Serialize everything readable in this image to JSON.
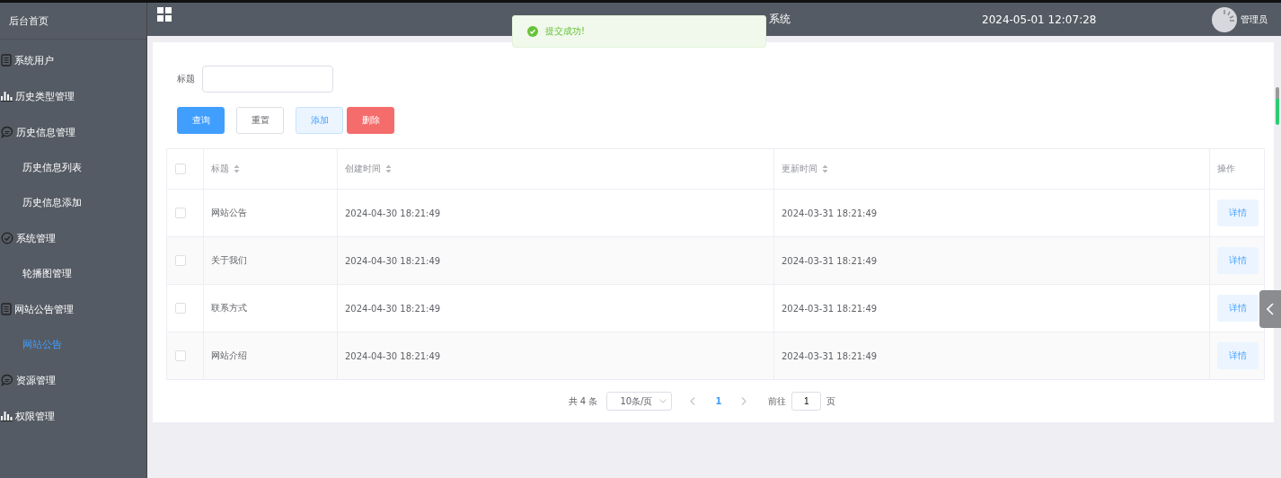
{
  "sidebar": {
    "items": [
      {
        "label": "后台首页",
        "kind": "plain",
        "selected": false
      },
      {
        "label": "系统用户",
        "kind": "doc",
        "selected": false
      },
      {
        "label": "历史类型管理",
        "kind": "bars",
        "selected": false
      },
      {
        "label": "历史信息管理",
        "kind": "chat",
        "selected": false,
        "children": [
          {
            "label": "历史信息列表",
            "selected": false
          },
          {
            "label": "历史信息添加",
            "selected": false
          }
        ]
      },
      {
        "label": "系统管理",
        "kind": "check",
        "selected": false,
        "children": [
          {
            "label": "轮播图管理",
            "selected": false
          }
        ]
      },
      {
        "label": "网站公告管理",
        "kind": "doc",
        "selected": false,
        "children": [
          {
            "label": "网站公告",
            "selected": true
          }
        ]
      },
      {
        "label": "资源管理",
        "kind": "chat",
        "selected": false
      },
      {
        "label": "权限管理",
        "kind": "bars",
        "selected": false
      }
    ]
  },
  "header": {
    "title": "系统",
    "datetime": "2024-05-01 12:07:28",
    "user": "管理员"
  },
  "toast": {
    "message": "提交成功!"
  },
  "search": {
    "label": "标题"
  },
  "buttons": [
    {
      "label": "查询",
      "kind": "primary"
    },
    {
      "label": "重置",
      "kind": "default"
    },
    {
      "label": "添加",
      "kind": "hover"
    },
    {
      "label": "删除",
      "kind": "danger"
    }
  ],
  "table": {
    "select_all_checked": false,
    "columns": [
      {
        "label": "标题",
        "sortable": true
      },
      {
        "label": "创建时间",
        "sortable": true
      },
      {
        "label": "更新时间",
        "sortable": true
      },
      {
        "label": "操作",
        "sortable": false
      }
    ],
    "rows": [
      {
        "checked": false,
        "title": "网站公告",
        "created": "2024-04-30 18:21:49",
        "updated": "2024-03-31 18:21:49",
        "action": "详情"
      },
      {
        "checked": false,
        "title": "关于我们",
        "created": "2024-04-30 18:21:49",
        "updated": "2024-03-31 18:21:49",
        "action": "详情"
      },
      {
        "checked": false,
        "title": "联系方式",
        "created": "2024-04-30 18:21:49",
        "updated": "2024-03-31 18:21:49",
        "action": "详情"
      },
      {
        "checked": false,
        "title": "网站介绍",
        "created": "2024-04-30 18:21:49",
        "updated": "2024-03-31 18:21:49",
        "action": "详情"
      }
    ]
  },
  "pagination": {
    "total": "共 4 条",
    "page_size": "10条/页",
    "current": "1",
    "goto_label": "前往",
    "goto_value": "1",
    "goto_suffix": "页"
  }
}
